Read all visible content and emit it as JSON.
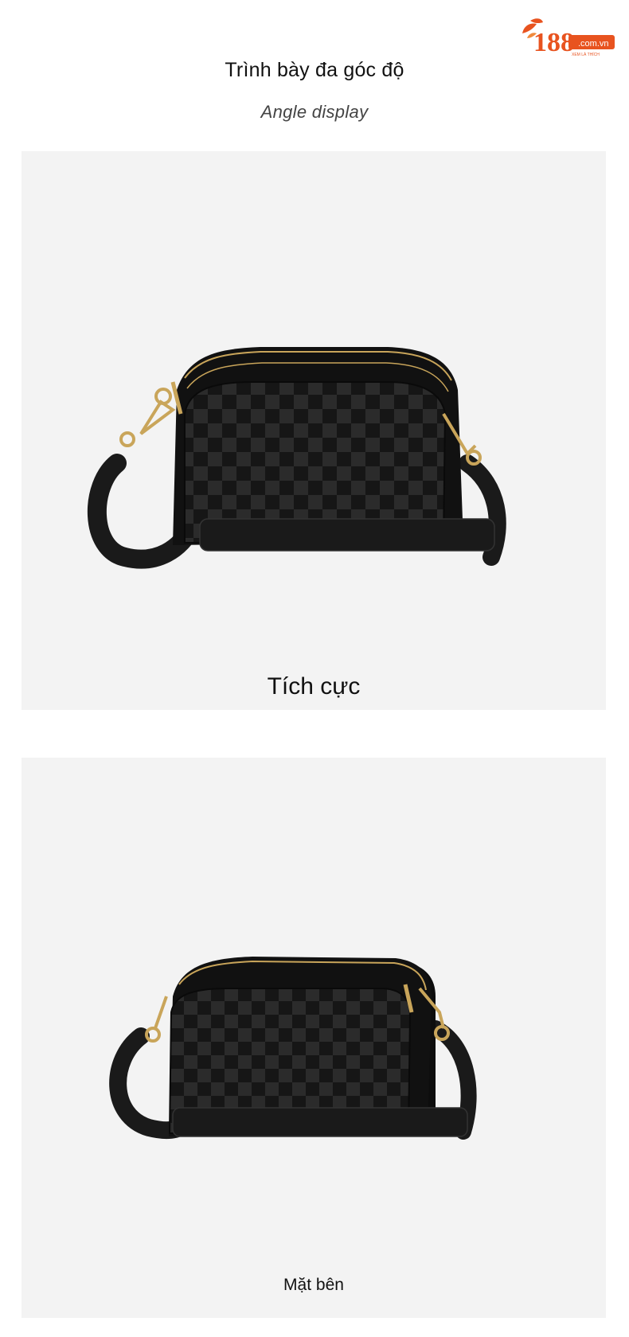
{
  "brand": {
    "logo_text": "188",
    "logo_domain": ".com.vn",
    "logo_tagline": "XEM LÀ THÍCH",
    "accent_color": "#e8531f"
  },
  "header": {
    "title_vi": "Trình bày đa góc độ",
    "title_en": "Angle display"
  },
  "views": [
    {
      "label": "Tích cực",
      "image": "black-quilted-leather-crossbody-bag-front"
    },
    {
      "label": "Mặt bên",
      "image": "black-quilted-leather-crossbody-bag-side"
    }
  ],
  "colors": {
    "panel_bg": "#f3f3f3",
    "bag_black": "#141414",
    "hardware_gold": "#c9a55a"
  }
}
